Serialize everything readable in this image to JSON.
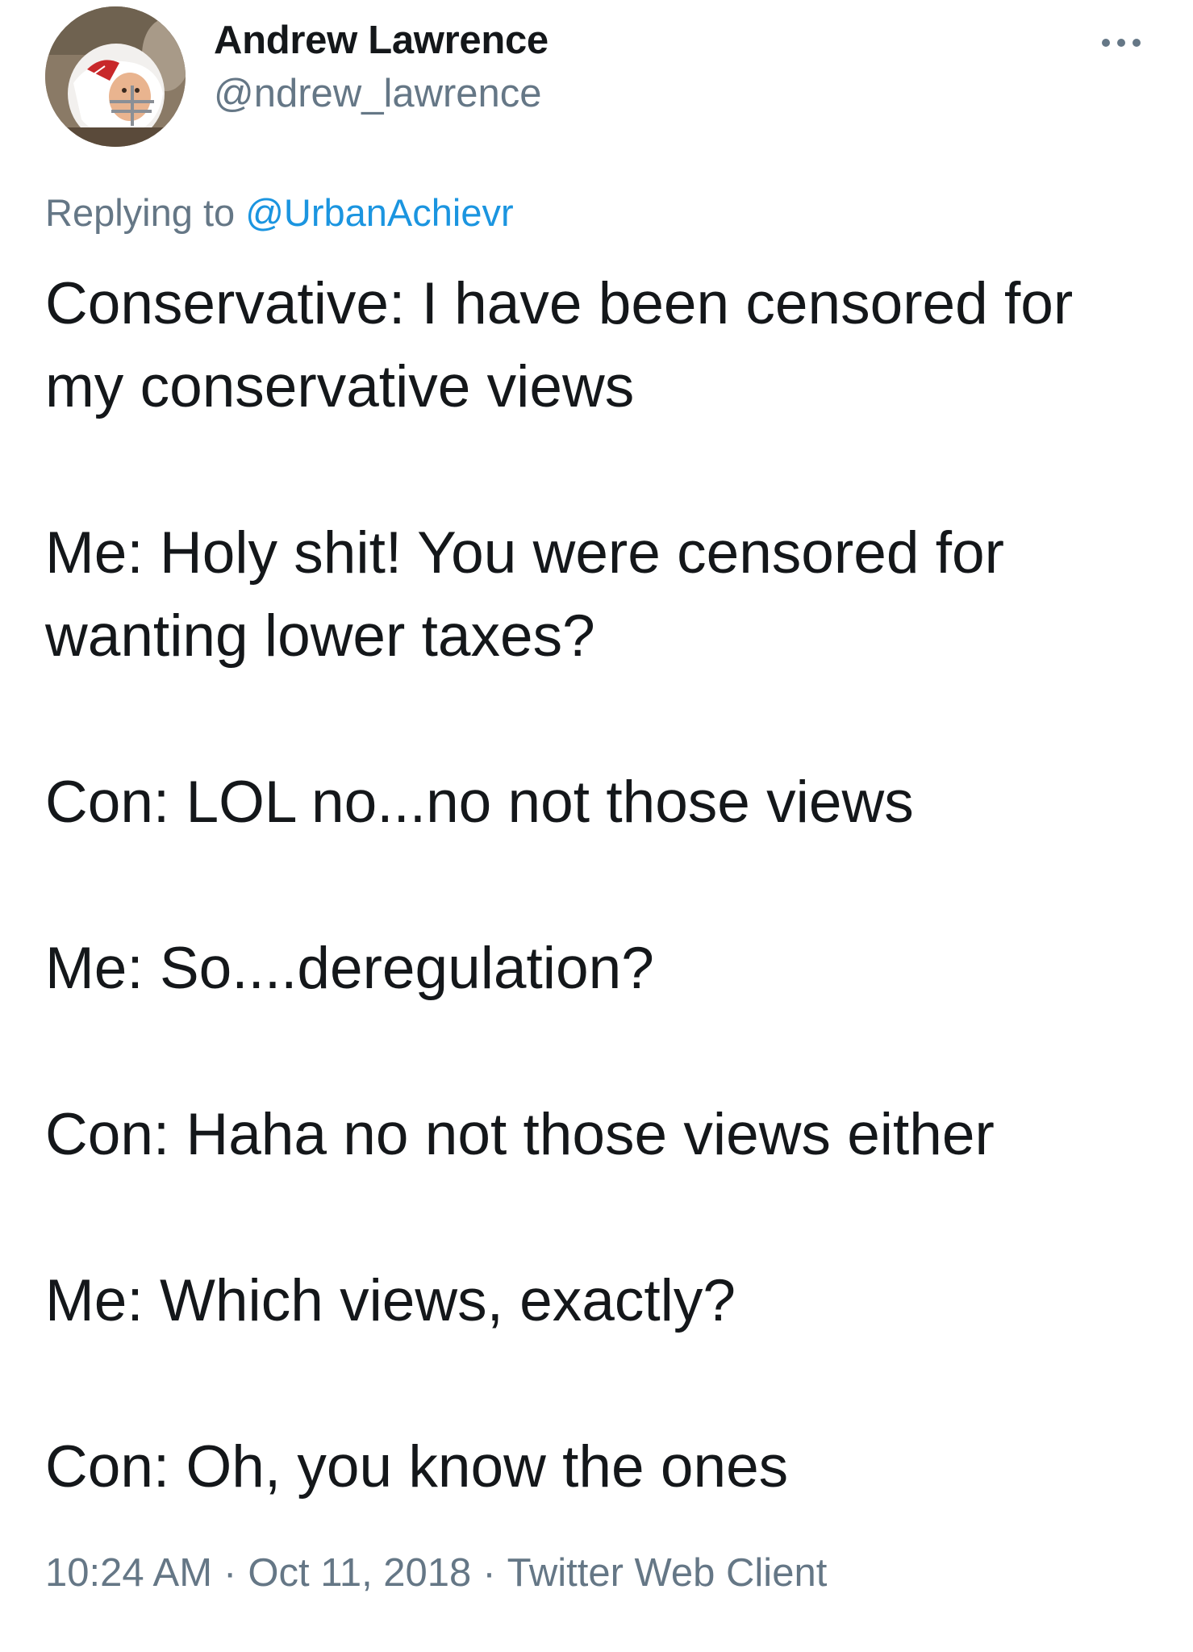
{
  "tweet": {
    "author": {
      "display_name": "Andrew Lawrence",
      "handle": "@ndrew_lawrence",
      "avatar": "profile-photo-child-in-football-helmet"
    },
    "more_icon": "more-horizontal-icon",
    "replying_prefix": "Replying to",
    "replying_to": "@UrbanAchievr",
    "body": [
      "Conservative: I have been censored for\nmy conservative views",
      "Me: Holy shit! You were censored for\nwanting lower taxes?",
      "Con: LOL no...no not those views",
      "Me: So....deregulation?",
      "Con: Haha no not those views either",
      "Me: Which views, exactly?",
      "Con: Oh, you know the ones"
    ],
    "time": "10:24 AM",
    "date": "Oct 11, 2018",
    "separator": "·",
    "source": "Twitter Web Client"
  },
  "colors": {
    "text_primary": "#14171a",
    "text_secondary": "#657786",
    "link": "#1b95e0",
    "background": "#ffffff"
  }
}
